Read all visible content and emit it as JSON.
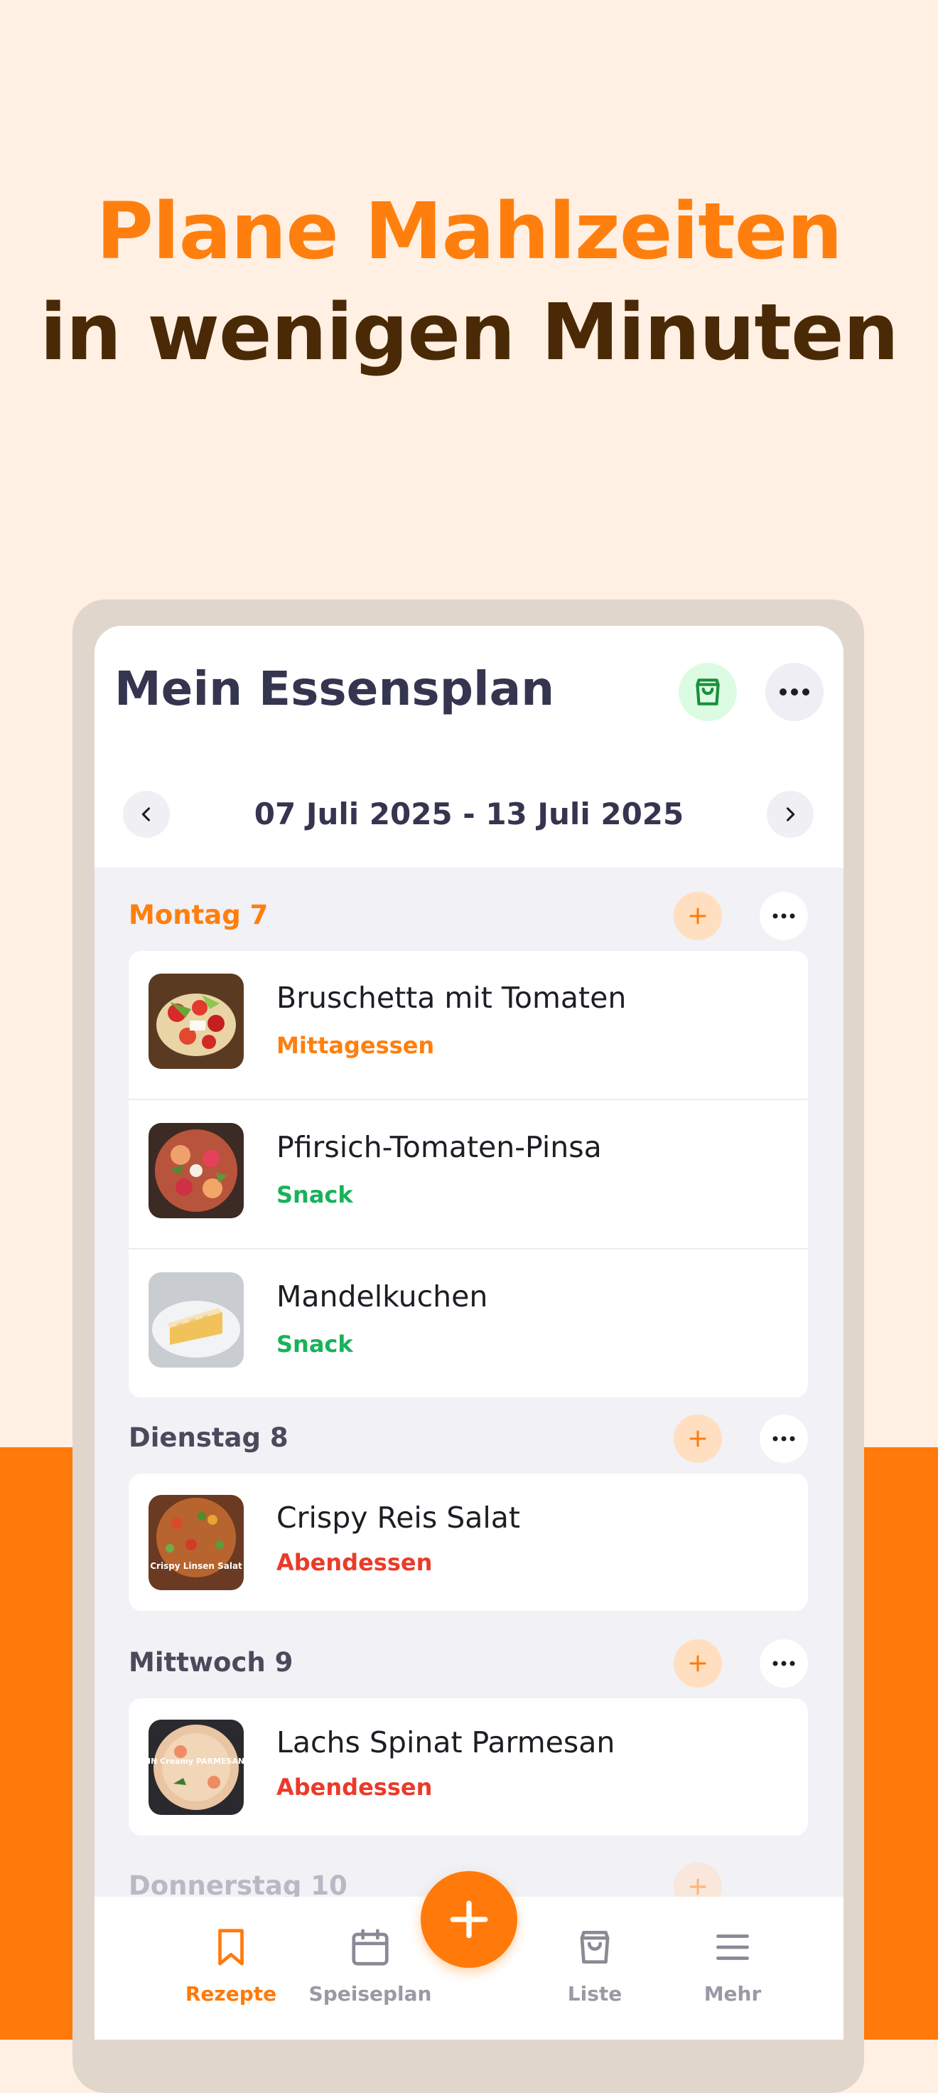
{
  "headline": {
    "line1": "Plane Mahlzeiten",
    "line2": "in wenigen Minuten"
  },
  "app": {
    "title": "Mein Essensplan",
    "week_range": "07 Juli 2025 - 13 Juli 2025"
  },
  "colors": {
    "accent": "#ff7a0a",
    "lunch": "#ff7f0e",
    "snack": "#18b25a",
    "dinner": "#ea3b2a",
    "title": "#363550"
  },
  "days": [
    {
      "label": "Montag 7",
      "meals": [
        {
          "name": "Bruschetta mit Tomaten",
          "type": "Mittagessen"
        },
        {
          "name": "Pfirsich-Tomaten-Pinsa",
          "type": "Snack"
        },
        {
          "name": "Mandelkuchen",
          "type": "Snack"
        }
      ]
    },
    {
      "label": "Dienstag 8",
      "meals": [
        {
          "name": "Crispy Reis Salat",
          "type": "Abendessen",
          "thumb_text": "Crispy Linsen Salat"
        }
      ]
    },
    {
      "label": "Mittwoch 9",
      "meals": [
        {
          "name": "Lachs Spinat Parmesan",
          "type": "Abendessen",
          "thumb_text": "LACHS IN Creamy PARMESAN SAUCE"
        }
      ]
    },
    {
      "label": "Donnerstag 10"
    }
  ],
  "icons": {
    "bag": "shopping-bag-icon",
    "more": "ellipsis-icon",
    "add": "plus-icon",
    "prev": "chevron-left-icon",
    "next": "chevron-right-icon"
  },
  "bottom_nav": {
    "tabs": [
      {
        "label": "Rezepte",
        "icon": "bookmark-icon",
        "active": true
      },
      {
        "label": "Speiseplan",
        "icon": "calendar-icon"
      },
      {
        "label": "Liste",
        "icon": "shopping-bag-icon"
      },
      {
        "label": "Mehr",
        "icon": "menu-icon"
      }
    ]
  }
}
